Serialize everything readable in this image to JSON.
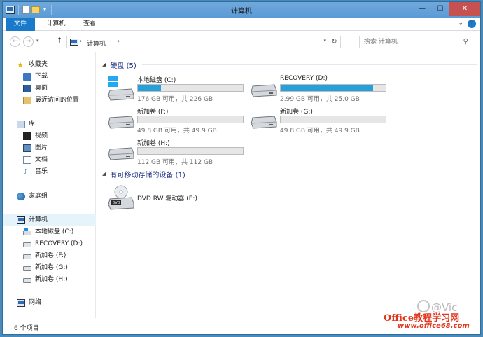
{
  "window": {
    "title": "计算机"
  },
  "titlebar": {
    "quick_access": [
      "computer-icon",
      "properties-icon",
      "new-folder-icon",
      "dropdown-icon"
    ],
    "buttons": {
      "minimize": "—",
      "maximize": "☐",
      "close": "✕"
    }
  },
  "ribbon": {
    "tabs": [
      {
        "label": "文件",
        "active": true
      },
      {
        "label": "计算机"
      },
      {
        "label": "查看"
      }
    ],
    "expand_icon": "⌄",
    "help_icon": "?"
  },
  "address": {
    "breadcrumb": "计算机",
    "separator": "›",
    "up_icon": "↑",
    "refresh_icon": "↻"
  },
  "search": {
    "placeholder": "搜索 计算机",
    "icon": "⚲"
  },
  "sidebar": {
    "favorites": {
      "label": "收藏夹",
      "items": [
        "下载",
        "桌面",
        "最近访问的位置"
      ]
    },
    "libraries": {
      "label": "库",
      "items": [
        "视频",
        "图片",
        "文档",
        "音乐"
      ]
    },
    "homegroup": {
      "label": "家庭组"
    },
    "computer": {
      "label": "计算机",
      "items": [
        "本地磁盘 (C:)",
        "RECOVERY (D:)",
        "新加卷 (F:)",
        "新加卷 (G:)",
        "新加卷 (H:)"
      ]
    },
    "network": {
      "label": "网络"
    }
  },
  "groups": {
    "harddisks": "硬盘 (5)",
    "removable": "有可移动存储的设备 (1)"
  },
  "drives": [
    {
      "name": "本地磁盘 (C:)",
      "info": "176 GB 可用，共 226 GB",
      "used_fraction": 0.22,
      "color": "#26a0da"
    },
    {
      "name": "RECOVERY (D:)",
      "info": "2.99 GB 可用，共 25.0 GB",
      "used_fraction": 0.88,
      "color": "#26a0da"
    },
    {
      "name": "新加卷 (F:)",
      "info": "49.8 GB 可用，共 49.9 GB",
      "used_fraction": 0.0
    },
    {
      "name": "新加卷 (G:)",
      "info": "49.8 GB 可用，共 49.9 GB",
      "used_fraction": 0.0
    },
    {
      "name": "新加卷 (H:)",
      "info": "112 GB 可用，共 112 GB",
      "used_fraction": 0.0
    }
  ],
  "removable_devices": [
    {
      "name": "DVD RW 驱动器 (E:)"
    }
  ],
  "status": {
    "item_count": "6 个项目"
  },
  "watermark": {
    "handle": "@Vic",
    "brand": "Office教程学习网",
    "url": "www.office68.com"
  }
}
